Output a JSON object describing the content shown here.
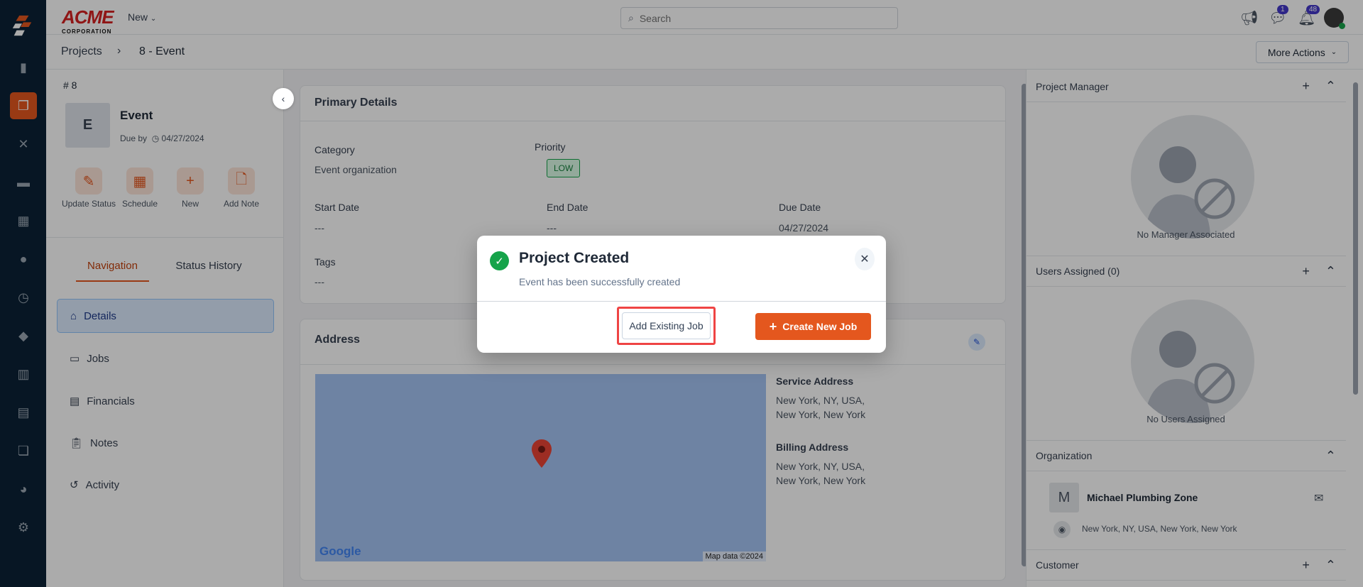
{
  "brand": {
    "logo_text": "ACME",
    "logo_sub": "CORPORATION",
    "new_menu": "New"
  },
  "search": {
    "placeholder": "Search"
  },
  "header": {
    "messages_badge": "1",
    "notifications_badge": "48"
  },
  "breadcrumb": {
    "root": "Projects",
    "current": "8 - Event"
  },
  "more_actions": "More Actions",
  "project": {
    "number": "# 8",
    "initial": "E",
    "name": "Event",
    "due_label": "Due by",
    "due_date": "04/27/2024"
  },
  "actions": [
    {
      "label": "Update Status"
    },
    {
      "label": "Schedule"
    },
    {
      "label": "New"
    },
    {
      "label": "Add Note"
    }
  ],
  "tabs": {
    "navigation": "Navigation",
    "status_history": "Status History"
  },
  "nav": [
    {
      "label": "Details"
    },
    {
      "label": "Jobs"
    },
    {
      "label": "Financials"
    },
    {
      "label": "Notes"
    },
    {
      "label": "Activity"
    }
  ],
  "primary": {
    "title": "Primary Details",
    "category_label": "Category",
    "category": "Event organization",
    "priority_label": "Priority",
    "priority": "LOW",
    "start_label": "Start Date",
    "start": "---",
    "end_label": "End Date",
    "end": "---",
    "due_label": "Due Date",
    "due": "04/27/2024",
    "tags_label": "Tags",
    "tags": "---"
  },
  "address": {
    "title": "Address",
    "service_label": "Service Address",
    "service_1": "New York, NY, USA,",
    "service_2": "New York, New York",
    "billing_label": "Billing Address",
    "billing_1": "New York, NY, USA,",
    "billing_2": "New York, New York",
    "map_logo": "Google",
    "map_credit": "Map data ©2024"
  },
  "right": {
    "manager_title": "Project Manager",
    "manager_empty": "No Manager Associated",
    "users_title": "Users Assigned (0)",
    "users_empty": "No Users Assigned",
    "org_title": "Organization",
    "org_initial": "M",
    "org_name": "Michael Plumbing Zone",
    "org_address": "New York, NY, USA, New York, New York",
    "customer_title": "Customer"
  },
  "modal": {
    "title": "Project Created",
    "message": "Event has been successfully created",
    "add_existing": "Add Existing Job",
    "create_new": "Create New Job"
  },
  "colors": {
    "accent": "#e4571e",
    "sidebar": "#0b2236",
    "success": "#16a34a",
    "highlight": "#ef4444"
  }
}
